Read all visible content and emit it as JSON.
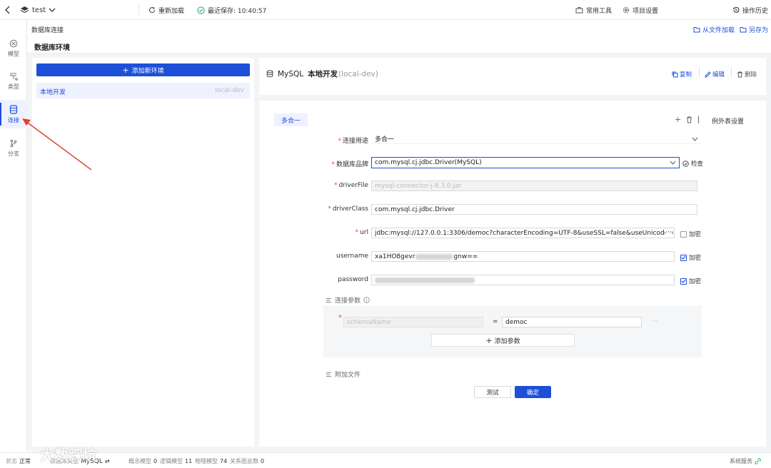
{
  "topbar": {
    "project": "test",
    "reload": "重新加载",
    "saved": "最近保存: 10:40:57",
    "tools": "常用工具",
    "settings": "项目设置",
    "history": "操作历史"
  },
  "sidebar": {
    "items": [
      {
        "label": "模型"
      },
      {
        "label": "类型"
      },
      {
        "label": "连接"
      },
      {
        "label": "分支"
      }
    ]
  },
  "breadcrumb": {
    "title": "数据库连接",
    "load": "从文件加载",
    "saveas": "另存为"
  },
  "section": {
    "title": "数据库环境"
  },
  "envpanel": {
    "add_label": "添加新环境",
    "env_name": "本地开发",
    "env_key": "local-dev"
  },
  "detail": {
    "db": "MySQL",
    "name": "本地开发",
    "key": "(local-dev)",
    "copy": "复制",
    "edit": "编辑",
    "delete": "删除"
  },
  "form": {
    "tab": "多合一",
    "exception": "例外表设置",
    "purpose_label": "连接用途",
    "purpose_value": "多合一",
    "brand_label": "数据库品牌",
    "brand_value": "com.mysql.cj.jdbc.Driver(MySQL)",
    "check": "检查",
    "driverfile_label": "driverFile",
    "driverfile_value": "mysql-connector-j-8.3.0.jar",
    "driverclass_label": "driverClass",
    "driverclass_value": "com.mysql.cj.jdbc.Driver",
    "url_label": "url",
    "url_value": "jdbc:mysql://127.0.0.1:3306/democ?characterEncoding=UTF-8&useSSL=false&useUnicode=tr",
    "username_label": "username",
    "username_value_start": "xa1HO8gevr",
    "username_value_end": "gnw==",
    "password_label": "password",
    "encrypt": "加密",
    "params_title": "连接参数",
    "param_key_placeholder": "schemaName",
    "param_eq": "=",
    "param_value": "democ",
    "add_param": "添加参数",
    "attach_title": "附加文件",
    "test": "测试",
    "ok": "确定"
  },
  "statusbar": {
    "state_label": "状态",
    "state_value": "正常",
    "dbtype_label": "数据库类型",
    "dbtype_value": "MySQL",
    "concept": "概念模型",
    "concept_n": "0",
    "logical": "逻辑模型",
    "logical_n": "11",
    "physical": "物理模型",
    "physical_n": "74",
    "relations": "关系图总数",
    "relations_n": "0",
    "service": "系统服务"
  },
  "watermark": "大数踩坑",
  "colors": {
    "primary": "#1d4fd8",
    "arrow": "#e0402e",
    "required": "#e5484d"
  }
}
